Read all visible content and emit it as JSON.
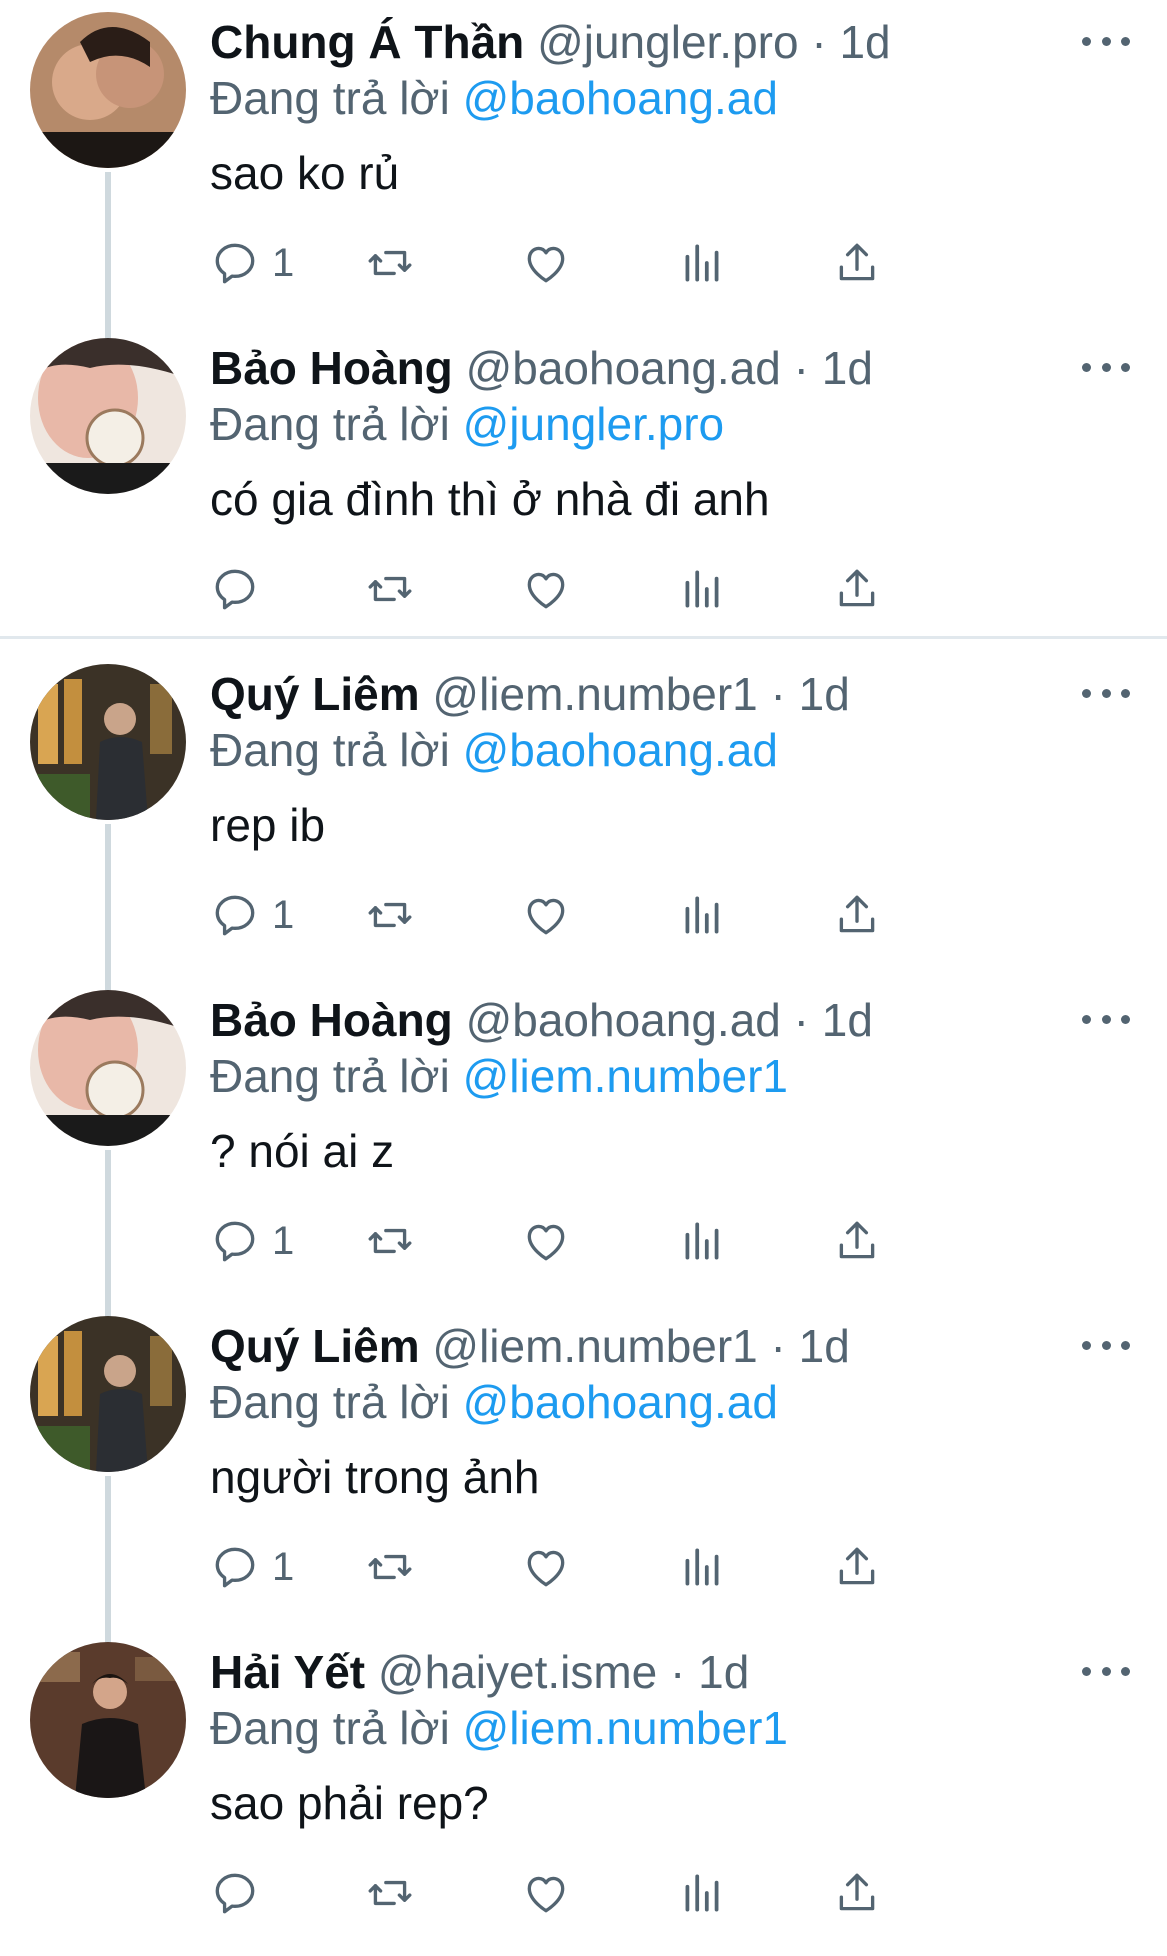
{
  "reply_prefix": "Đang trả lời",
  "dot": "·",
  "tweets": [
    {
      "name": "Chung Á Thần",
      "handle": "@jungler.pro",
      "time": "1d",
      "reply_to": "@baohoang.ad",
      "text": "sao ko rủ",
      "reply_count": "1"
    },
    {
      "name": "Bảo Hoàng",
      "handle": "@baohoang.ad",
      "time": "1d",
      "reply_to": "@jungler.pro",
      "text": "có gia đình thì ở nhà đi anh",
      "reply_count": ""
    },
    {
      "name": "Quý Liêm",
      "handle": "@liem.number1",
      "time": "1d",
      "reply_to": "@baohoang.ad",
      "text": "rep ib",
      "reply_count": "1"
    },
    {
      "name": "Bảo Hoàng",
      "handle": "@baohoang.ad",
      "time": "1d",
      "reply_to": "@liem.number1",
      "text": "? nói ai z",
      "reply_count": "1"
    },
    {
      "name": "Quý Liêm",
      "handle": "@liem.number1",
      "time": "1d",
      "reply_to": "@baohoang.ad",
      "text": "người trong ảnh",
      "reply_count": "1"
    },
    {
      "name": "Hải Yết",
      "handle": "@haiyet.isme",
      "time": "1d",
      "reply_to": "@liem.number1",
      "text": "sao phải rep?",
      "reply_count": ""
    }
  ],
  "icons": {
    "reply": "reply-icon",
    "retweet": "retweet-icon",
    "like": "heart-icon",
    "views": "views-icon",
    "share": "share-icon",
    "more": "more-icon"
  },
  "colors": {
    "mention": "#1d9bf0",
    "muted": "#536471",
    "text": "#0f1419"
  }
}
